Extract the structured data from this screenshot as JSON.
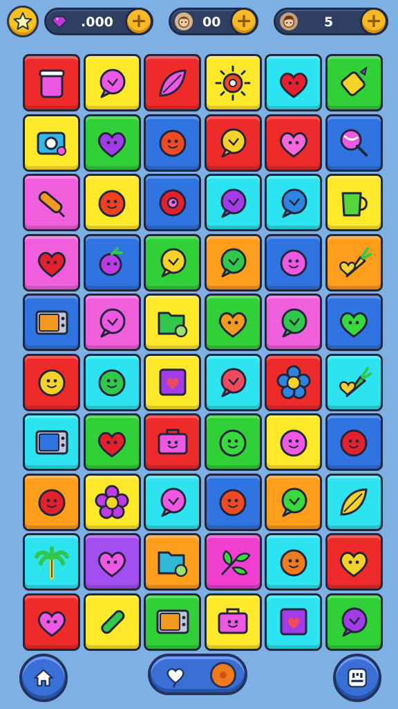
{
  "hud": {
    "gems": {
      "value": ".000",
      "icon": "gem-icon",
      "color": "#c03bd6"
    },
    "coins": {
      "value": "00",
      "icon": "avatar-icon"
    },
    "lives": {
      "value": "5",
      "icon": "avatar-icon"
    },
    "star_icon": "star-icon",
    "plus_label": "+"
  },
  "colors": {
    "red": "#ee2a2a",
    "yellow": "#ffe92a",
    "green": "#31d038",
    "blue": "#2f74e0",
    "cyan": "#2de3f0",
    "pink": "#f060dc",
    "orange": "#ff9d1c",
    "purple": "#a34ff0",
    "magenta": "#f03fd0",
    "lime": "#39d83e"
  },
  "grid": {
    "rows": [
      [
        {
          "bg": "red",
          "icon": "jar",
          "fg": "#ee58e2"
        },
        {
          "bg": "yellow",
          "icon": "bubble",
          "fg": "#ee58e2"
        },
        {
          "bg": "red",
          "icon": "leaf",
          "fg": "#ee58e2"
        },
        {
          "bg": "yellow",
          "icon": "sun",
          "fg": "#f04a25"
        },
        {
          "bg": "cyan",
          "icon": "heart",
          "fg": "#e6202c"
        },
        {
          "bg": "green",
          "icon": "candy",
          "fg": "#f5d22a"
        }
      ],
      [
        {
          "bg": "yellow",
          "icon": "camera",
          "fg": "#30b8e8"
        },
        {
          "bg": "green",
          "icon": "heart",
          "fg": "#a23be8"
        },
        {
          "bg": "blue",
          "icon": "face",
          "fg": "#f04a25"
        },
        {
          "bg": "red",
          "icon": "bubble",
          "fg": "#f5d22a"
        },
        {
          "bg": "red",
          "icon": "heart",
          "fg": "#f36ad8"
        },
        {
          "bg": "blue",
          "icon": "lollipop",
          "fg": "#ee58e2"
        }
      ],
      [
        {
          "bg": "pink",
          "icon": "pencil",
          "fg": "#f29a20"
        },
        {
          "bg": "yellow",
          "icon": "face",
          "fg": "#ef4020"
        },
        {
          "bg": "blue",
          "icon": "donut",
          "fg": "#e4202c"
        },
        {
          "bg": "cyan",
          "icon": "bubble",
          "fg": "#a23be8"
        },
        {
          "bg": "cyan",
          "icon": "bubble",
          "fg": "#2f84e0"
        },
        {
          "bg": "yellow",
          "icon": "cup",
          "fg": "#52d63a"
        }
      ],
      [
        {
          "bg": "pink",
          "icon": "heart",
          "fg": "#e4202c"
        },
        {
          "bg": "blue",
          "icon": "berry",
          "fg": "#c03be8"
        },
        {
          "bg": "green",
          "icon": "bubble",
          "fg": "#f5d22a"
        },
        {
          "bg": "orange",
          "icon": "bubble",
          "fg": "#31c74a"
        },
        {
          "bg": "blue",
          "icon": "face",
          "fg": "#ee58e2"
        },
        {
          "bg": "orange",
          "icon": "carrot",
          "fg": "#f5d22a"
        }
      ],
      [
        {
          "bg": "blue",
          "icon": "tv",
          "fg": "#f29a20"
        },
        {
          "bg": "pink",
          "icon": "bubble",
          "fg": "#ee58e2"
        },
        {
          "bg": "yellow",
          "icon": "folder",
          "fg": "#31c74a"
        },
        {
          "bg": "green",
          "icon": "heart",
          "fg": "#f29a20"
        },
        {
          "bg": "pink",
          "icon": "bubble",
          "fg": "#31c74a"
        },
        {
          "bg": "blue",
          "icon": "heart",
          "fg": "#39d83e"
        }
      ],
      [
        {
          "bg": "red",
          "icon": "face",
          "fg": "#f5d22a"
        },
        {
          "bg": "cyan",
          "icon": "face",
          "fg": "#31c74a"
        },
        {
          "bg": "yellow",
          "icon": "square",
          "fg": "#a23be8"
        },
        {
          "bg": "cyan",
          "icon": "bubble",
          "fg": "#f04a60"
        },
        {
          "bg": "red",
          "icon": "flower",
          "fg": "#2f84e0"
        },
        {
          "bg": "cyan",
          "icon": "carrot",
          "fg": "#31c74a"
        }
      ],
      [
        {
          "bg": "cyan",
          "icon": "tv",
          "fg": "#2f74e0"
        },
        {
          "bg": "green",
          "icon": "heart",
          "fg": "#e4202c"
        },
        {
          "bg": "red",
          "icon": "bag",
          "fg": "#ee58e2"
        },
        {
          "bg": "green",
          "icon": "face",
          "fg": "#39d83e"
        },
        {
          "bg": "yellow",
          "icon": "face",
          "fg": "#ee58e2"
        },
        {
          "bg": "blue",
          "icon": "face",
          "fg": "#e4202c"
        }
      ],
      [
        {
          "bg": "orange",
          "icon": "face",
          "fg": "#e4202c"
        },
        {
          "bg": "yellow",
          "icon": "flower",
          "fg": "#c03be8"
        },
        {
          "bg": "cyan",
          "icon": "bubble",
          "fg": "#ee58e2"
        },
        {
          "bg": "blue",
          "icon": "face",
          "fg": "#f04a25"
        },
        {
          "bg": "orange",
          "icon": "bubble",
          "fg": "#39d83e"
        },
        {
          "bg": "cyan",
          "icon": "leaf",
          "fg": "#f5d22a"
        }
      ],
      [
        {
          "bg": "cyan",
          "icon": "palm",
          "fg": "#31c74a"
        },
        {
          "bg": "purple",
          "icon": "heart",
          "fg": "#ee58e2"
        },
        {
          "bg": "orange",
          "icon": "folder",
          "fg": "#2fb8d8"
        },
        {
          "bg": "magenta",
          "icon": "sprout",
          "fg": "#39d83e"
        },
        {
          "bg": "cyan",
          "icon": "face",
          "fg": "#f07b1e"
        },
        {
          "bg": "red",
          "icon": "heart",
          "fg": "#f5d22a"
        }
      ],
      [
        {
          "bg": "red",
          "icon": "heart",
          "fg": "#ee58e2"
        },
        {
          "bg": "yellow",
          "icon": "marker",
          "fg": "#31c74a"
        },
        {
          "bg": "green",
          "icon": "tv",
          "fg": "#f29a20"
        },
        {
          "bg": "yellow",
          "icon": "bag",
          "fg": "#ee58e2"
        },
        {
          "bg": "cyan",
          "icon": "square",
          "fg": "#a23be8"
        },
        {
          "bg": "green",
          "icon": "bubble",
          "fg": "#a23be8"
        }
      ]
    ]
  },
  "bottom": {
    "home_icon": "home-icon",
    "center_left_icon": "heart-tag-icon",
    "center_right_icon": "orange-dot-icon",
    "settings_icon": "settings-icon"
  }
}
